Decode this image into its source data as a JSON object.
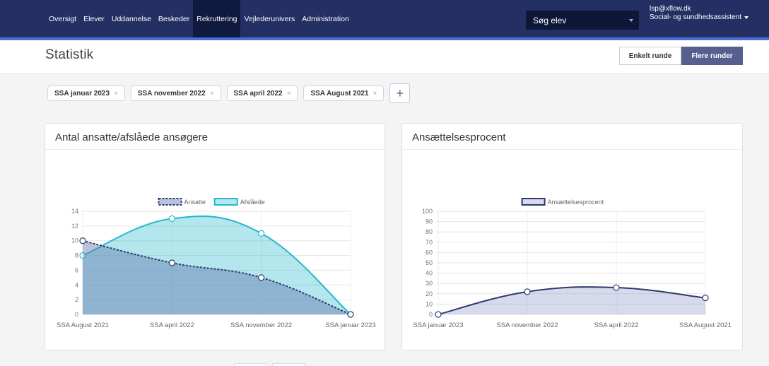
{
  "nav": {
    "items": [
      "Oversigt",
      "Elever",
      "Uddannelse",
      "Beskeder",
      "Rekruttering",
      "Vejlederunivers",
      "Administration"
    ],
    "active_index": 4,
    "search_label": "Søg elev",
    "user_email": "lsp@xflow.dk",
    "user_role": "Social- og sundhedsassistent"
  },
  "page": {
    "title": "Statistik",
    "seg_single": "Enkelt runde",
    "seg_multi": "Flere runder"
  },
  "chips": [
    "SSA januar 2023",
    "SSA november 2022",
    "SSA april 2022",
    "SSA August 2021"
  ],
  "add_symbol": "+",
  "chip_close": "×",
  "colors": {
    "nav_bg": "#243063",
    "accent": "#55608f",
    "ansatte": "#2f3a6e",
    "afslaede": "#26b8cc"
  },
  "chart_data": [
    {
      "type": "area",
      "title": "Antal ansatte/afslåede ansøgere",
      "categories": [
        "SSA August 2021",
        "SSA april 2022",
        "SSA november 2022",
        "SSA januar 2023"
      ],
      "series": [
        {
          "name": "Ansatte",
          "values": [
            10,
            7,
            5,
            0
          ],
          "style": "dashed"
        },
        {
          "name": "Afslåede",
          "values": [
            8,
            13,
            11,
            0
          ],
          "style": "solid"
        }
      ],
      "ylim": [
        0,
        14
      ],
      "yticks": [
        0,
        2,
        4,
        6,
        8,
        10,
        12,
        14
      ],
      "legend": "top-center",
      "grid": true
    },
    {
      "type": "area",
      "title": "Ansættelsesprocent",
      "categories": [
        "SSA januar 2023",
        "SSA november 2022",
        "SSA april 2022",
        "SSA August 2021"
      ],
      "series": [
        {
          "name": "Ansættelsesprocent",
          "values": [
            0,
            22,
            26,
            16
          ]
        }
      ],
      "ylim": [
        0,
        100
      ],
      "yticks": [
        0,
        10,
        20,
        30,
        40,
        50,
        60,
        70,
        80,
        90,
        100
      ],
      "legend": "top-center",
      "grid": true
    }
  ]
}
